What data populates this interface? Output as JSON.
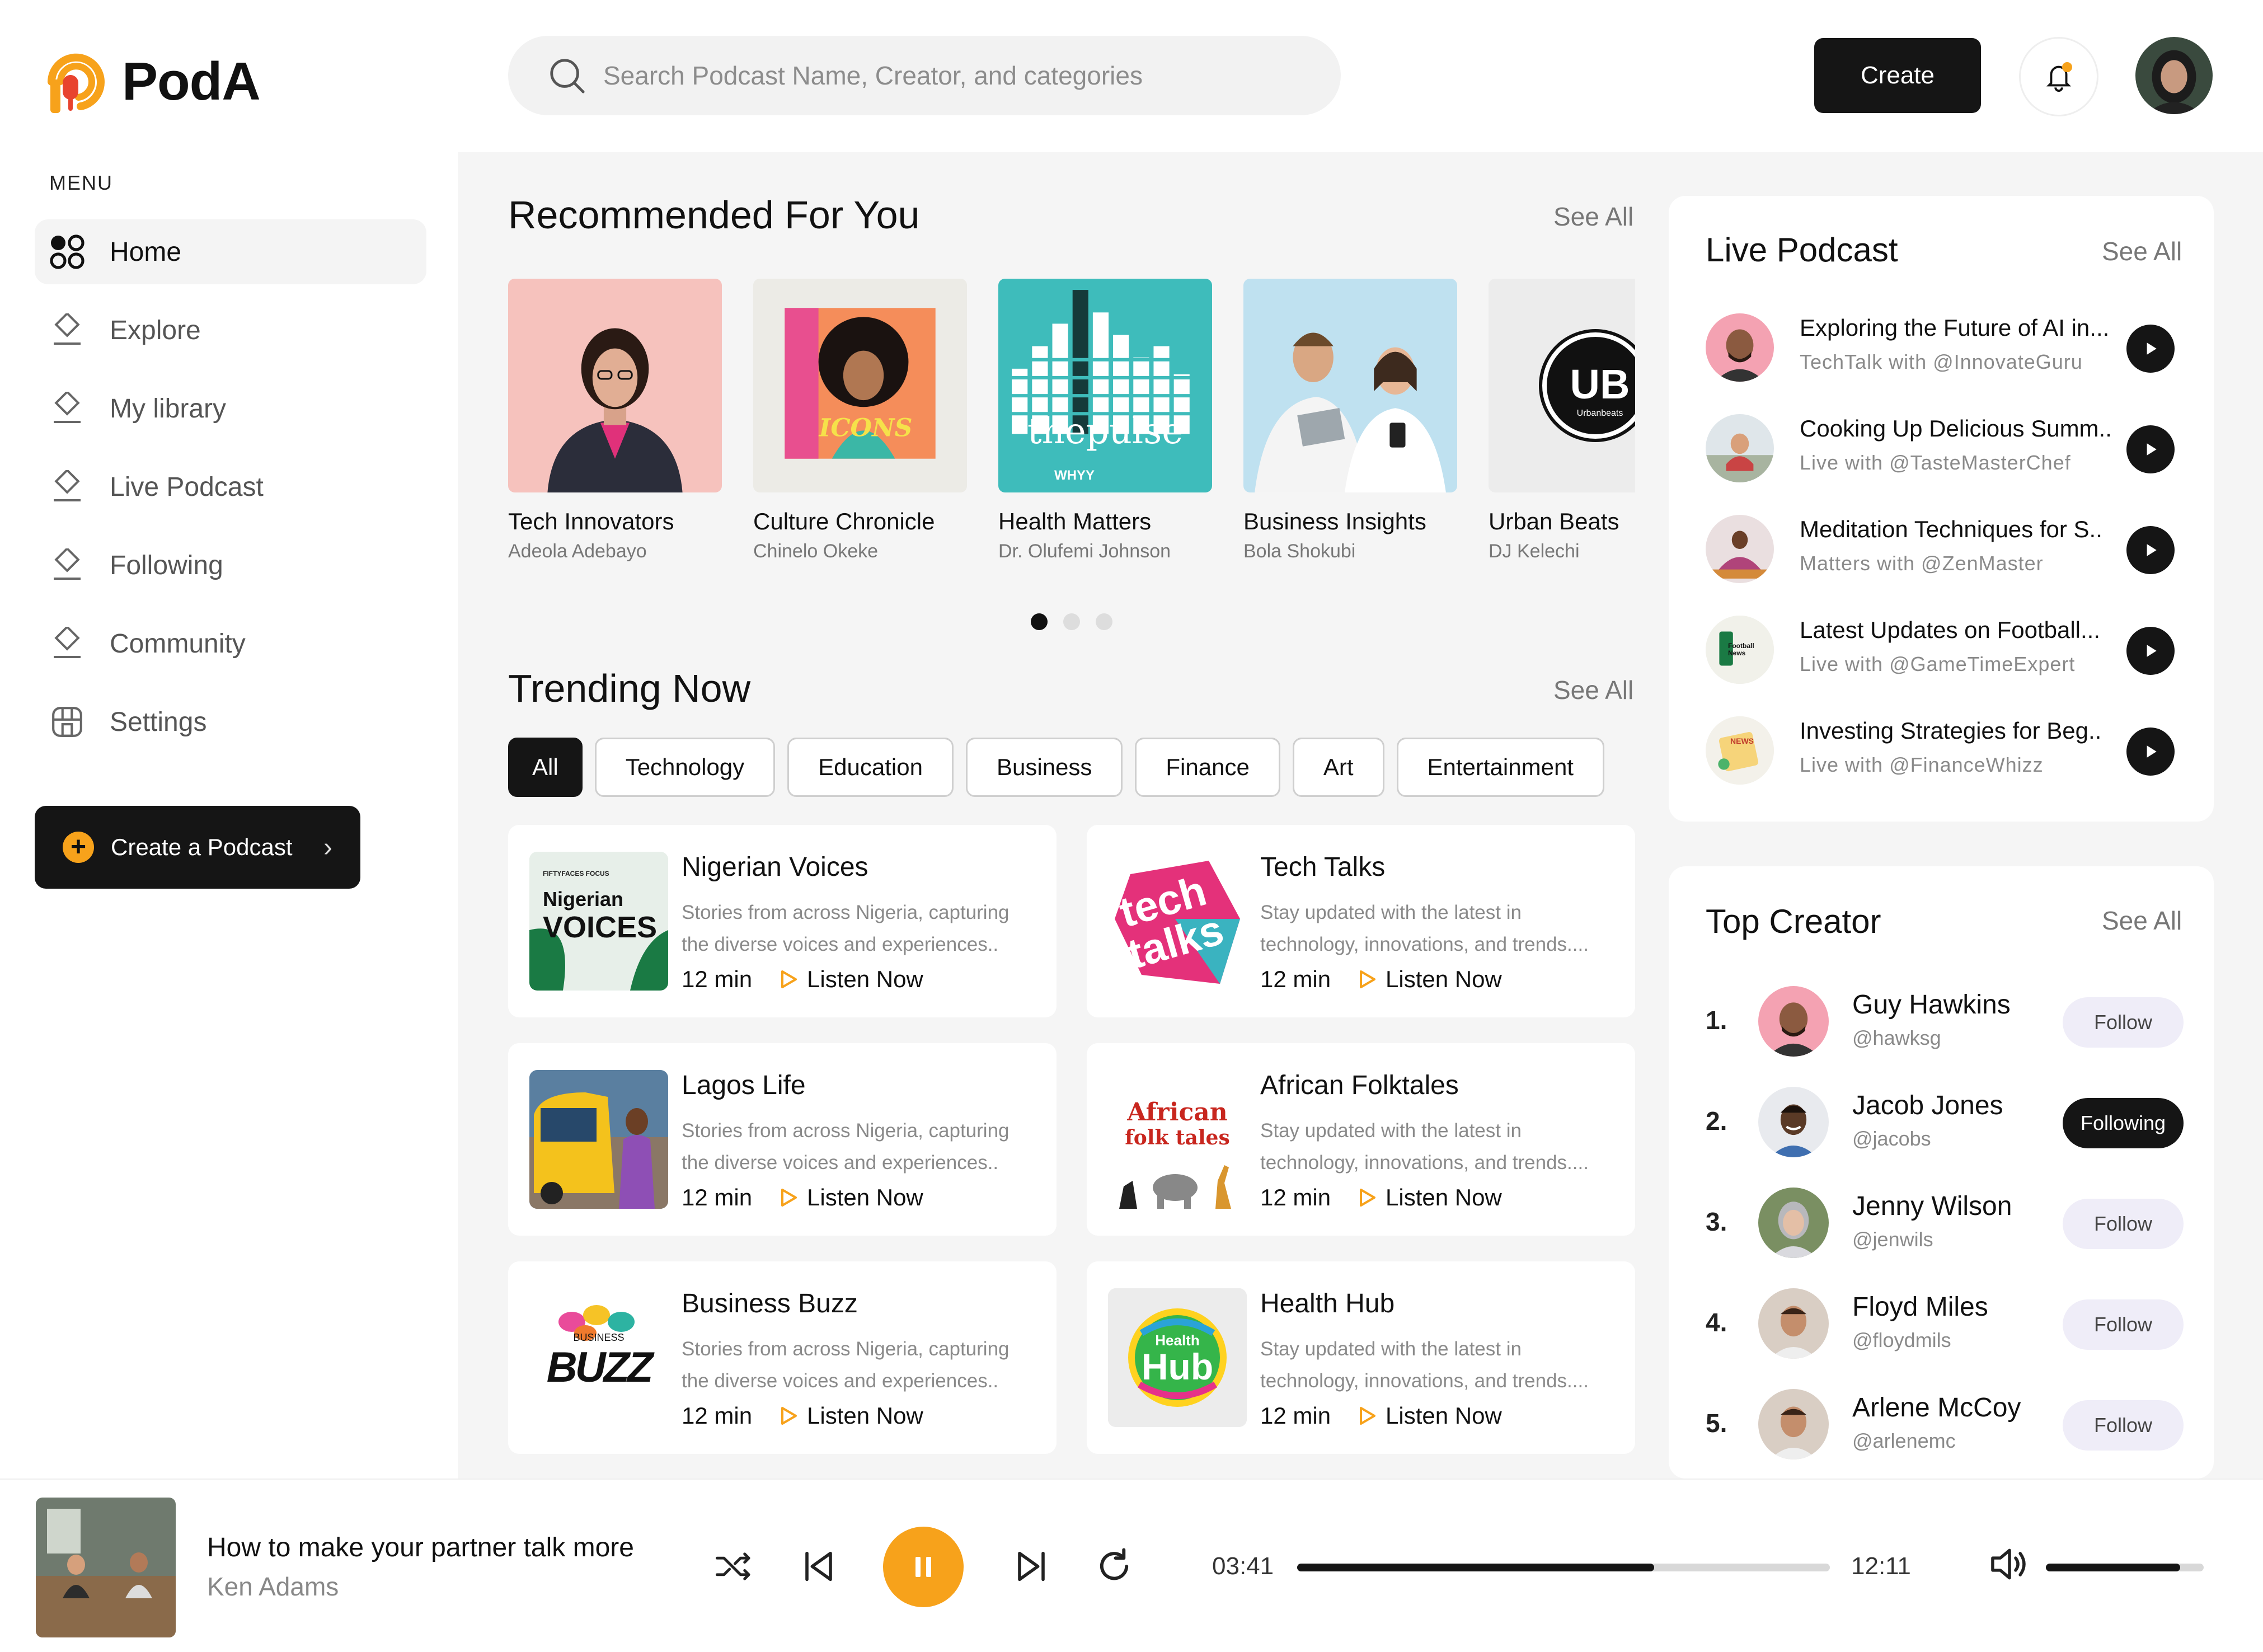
{
  "brand": {
    "name": "PodA",
    "accent": "#F7A21B",
    "dark": "#151515"
  },
  "header": {
    "search_placeholder": "Search Podcast Name, Creator, and categories",
    "create_label": "Create"
  },
  "sidebar": {
    "menu_title": "MENU",
    "items": [
      {
        "label": "Home",
        "icon": "grid-icon",
        "active": true
      },
      {
        "label": "Explore",
        "icon": "diamond-icon"
      },
      {
        "label": "My library",
        "icon": "diamond-icon"
      },
      {
        "label": "Live Podcast",
        "icon": "diamond-icon"
      },
      {
        "label": "Following",
        "icon": "diamond-icon"
      },
      {
        "label": "Community",
        "icon": "diamond-icon"
      },
      {
        "label": "Settings",
        "icon": "settings-icon"
      }
    ],
    "create_podcast_label": "Create a Podcast"
  },
  "recommended": {
    "title": "Recommended For You",
    "see_all": "See All",
    "items": [
      {
        "name": "Tech Innovators",
        "author": "Adeola Adebayo"
      },
      {
        "name": "Culture Chronicle",
        "author": "Chinelo Okeke"
      },
      {
        "name": "Health Matters",
        "author": "Dr. Olufemi Johnson",
        "cover_text": "thepulse",
        "cover_sub": "WHYY"
      },
      {
        "name": "Business Insights",
        "author": "Bola Shokubi"
      },
      {
        "name": "Urban Beats",
        "author": "DJ Kelechi",
        "cover_text": "UB",
        "cover_sub": "Urbanbeats"
      }
    ],
    "culture_cover_text": "ICONS",
    "carousel_pages": 3,
    "carousel_active": 0
  },
  "trending": {
    "title": "Trending Now",
    "see_all": "See All",
    "categories": [
      "All",
      "Technology",
      "Education",
      "Business",
      "Finance",
      "Art",
      "Entertainment"
    ],
    "listen_label": "Listen Now",
    "items": [
      {
        "title": "Nigerian Voices",
        "desc": "Stories from across Nigeria, capturing the diverse voices and experiences..",
        "duration": "12 min",
        "cover_top": "FIFTYFACES FOCUS",
        "cover_a": "Nigerian",
        "cover_b": "VOICES"
      },
      {
        "title": "Tech Talks",
        "desc": "Stay updated with the latest in technology, innovations, and trends....",
        "duration": "12 min",
        "cover_a": "tech",
        "cover_b": "talks"
      },
      {
        "title": "Lagos Life",
        "desc": "Stories from across Nigeria, capturing the diverse voices and experiences..",
        "duration": "12 min"
      },
      {
        "title": "African Folktales",
        "desc": "Stay updated with the latest in technology, innovations, and trends....",
        "duration": "12 min",
        "cover_a": "African",
        "cover_b": "folk tales"
      },
      {
        "title": "Business Buzz",
        "desc": "Stories from across Nigeria, capturing the diverse voices and experiences..",
        "duration": "12 min",
        "cover_a": "BUSINESS",
        "cover_b": "BUZZ"
      },
      {
        "title": "Health Hub",
        "desc": "Stay updated with the latest in technology, innovations, and trends....",
        "duration": "12 min",
        "cover_a": "Health",
        "cover_b": "Hub"
      }
    ]
  },
  "live": {
    "title": "Live Podcast",
    "see_all": "See All",
    "items": [
      {
        "title": "Exploring the Future of AI in...",
        "sub": "TechTalk with @InnovateGuru"
      },
      {
        "title": "Cooking Up Delicious Summ..",
        "sub": "Live with @TasteMasterChef"
      },
      {
        "title": "Meditation Techniques for S..",
        "sub": "Matters with @ZenMaster"
      },
      {
        "title": "Latest Updates on Football...",
        "sub": "Live with @GameTimeExpert",
        "cover_text": "Football News"
      },
      {
        "title": "Investing Strategies for Beg..",
        "sub": "Live with @FinanceWhizz",
        "cover_text": "NEWS"
      }
    ]
  },
  "creators": {
    "title": "Top Creator",
    "see_all": "See All",
    "items": [
      {
        "rank": "1.",
        "name": "Guy Hawkins",
        "handle": "@hawksg",
        "button": "Follow",
        "following": false
      },
      {
        "rank": "2.",
        "name": "Jacob Jones",
        "handle": "@jacobs",
        "button": "Following",
        "following": true
      },
      {
        "rank": "3.",
        "name": "Jenny Wilson",
        "handle": "@jenwils",
        "button": "Follow",
        "following": false
      },
      {
        "rank": "4.",
        "name": "Floyd Miles",
        "handle": "@floydmils",
        "button": "Follow",
        "following": false
      },
      {
        "rank": "5.",
        "name": "Arlene McCoy",
        "handle": "@arlenemc",
        "button": "Follow",
        "following": false
      }
    ]
  },
  "player": {
    "title": "How to make your partner talk more",
    "artist": "Ken Adams",
    "current_time": "03:41",
    "total_time": "12:11",
    "progress": 0.67,
    "volume": 0.85
  }
}
